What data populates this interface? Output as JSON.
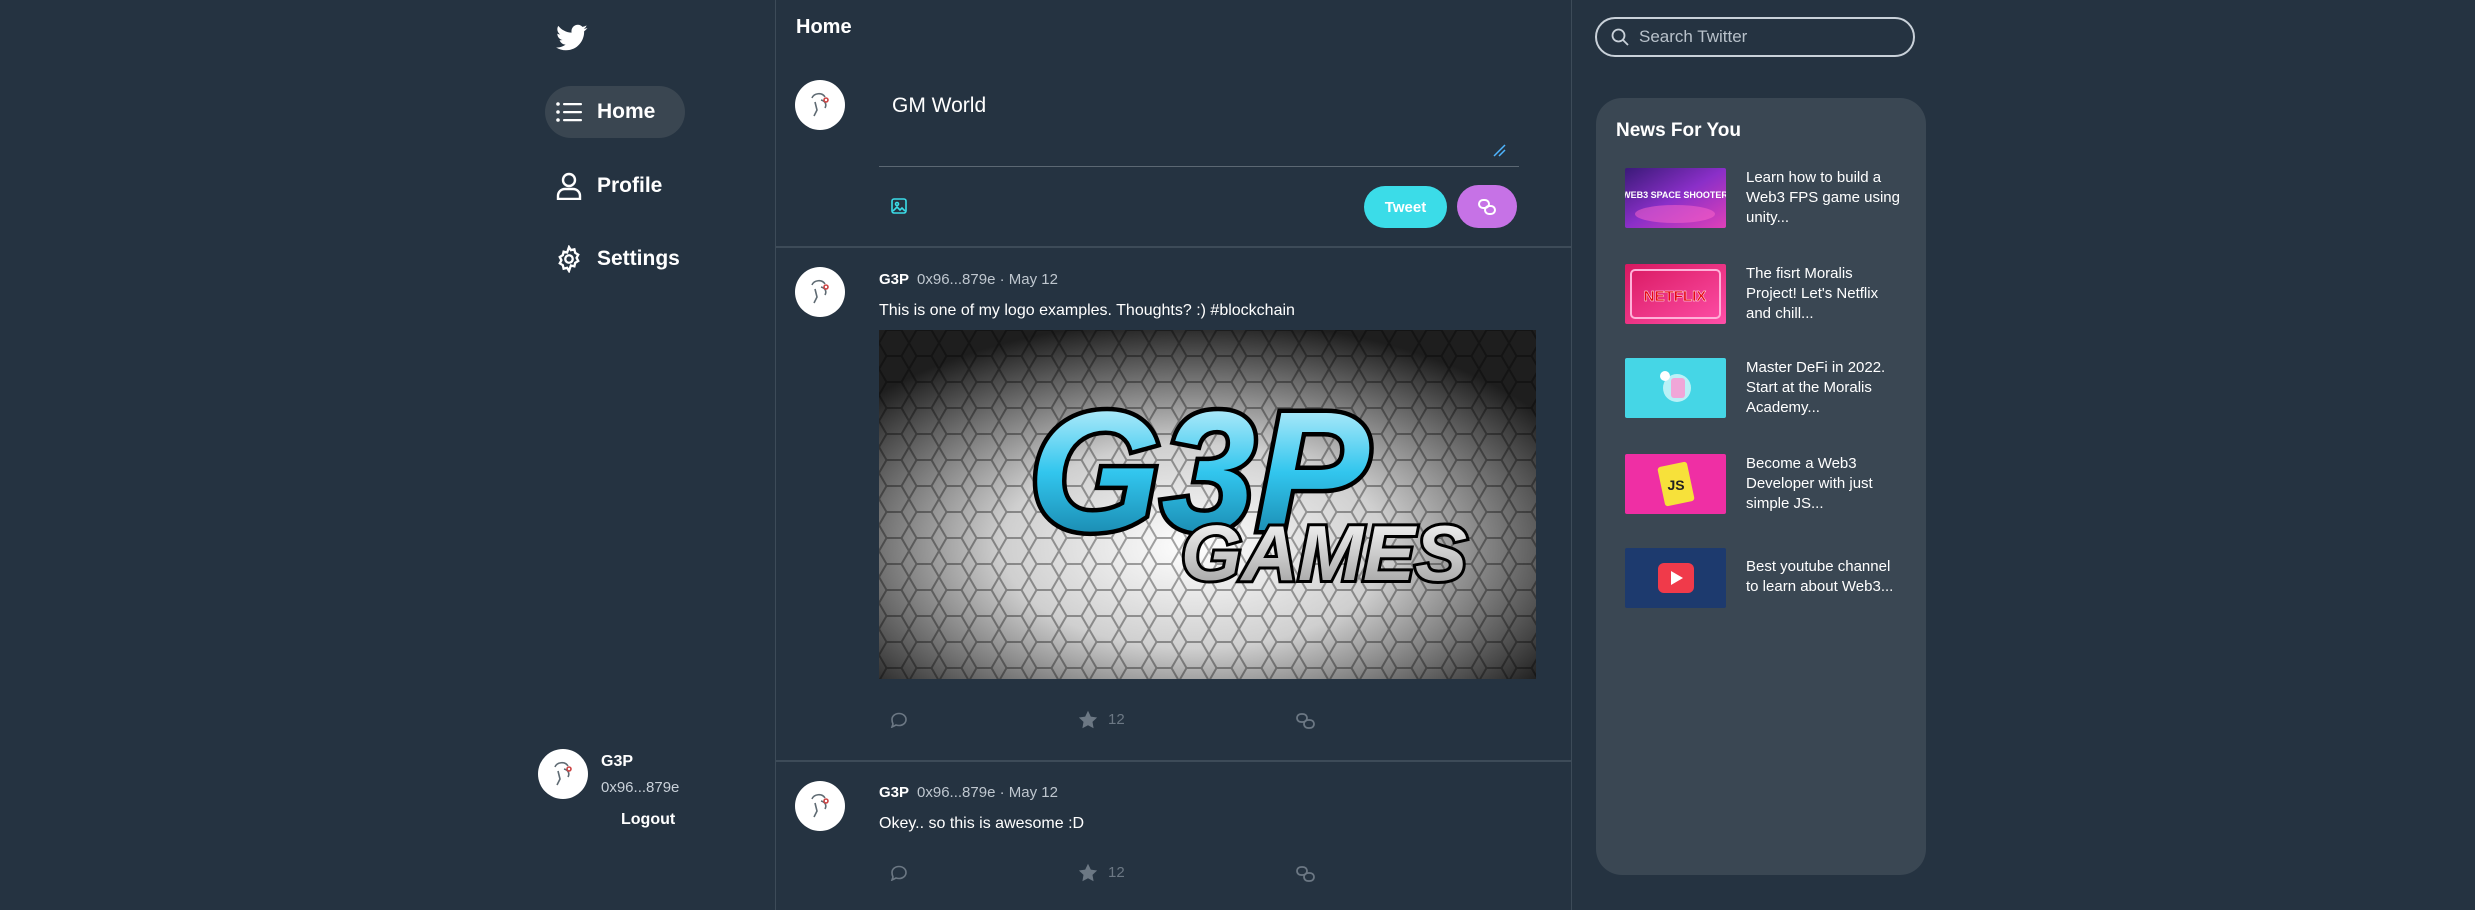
{
  "nav": {
    "home_label": "Home",
    "profile_label": "Profile",
    "settings_label": "Settings"
  },
  "user": {
    "name": "G3P",
    "handle": "0x96...879e",
    "logout_label": "Logout"
  },
  "feed": {
    "title": "Home",
    "compose_text": "GM World",
    "tweet_button": "Tweet"
  },
  "posts": [
    {
      "name": "G3P",
      "meta": "0x96...879e · May 12",
      "text": "This is one of my logo examples. Thoughts? :) #blockchain",
      "likes": "12",
      "image_text_top": "G3P",
      "image_text_bottom": "GAMES"
    },
    {
      "name": "G3P",
      "meta": "0x96...879e · May 12",
      "text": "Okey.. so this is awesome :D",
      "likes": "12"
    }
  ],
  "search": {
    "placeholder": "Search Twitter"
  },
  "news": {
    "title": "News For You",
    "items": [
      {
        "text": "Learn how to build a Web3 FPS game using unity...",
        "thumb_text": "WEB3 SPACE SHOOTER"
      },
      {
        "text": "The fisrt Moralis Project! Let's Netflix and chill...",
        "thumb_text": "NETFLIX"
      },
      {
        "text": "Master DeFi in 2022. Start at the Moralis Academy..."
      },
      {
        "text": "Become a Web3 Developer with just simple JS...",
        "thumb_text": "JS"
      },
      {
        "text": "Best youtube channel to learn about Web3..."
      }
    ]
  },
  "colors": {
    "background": "#253341",
    "panel": "#3a4753",
    "tweet_button": "#3bdce8",
    "nft_button": "#c672e6",
    "action_gray": "#6c7884"
  },
  "icons": [
    "twitter-bird-icon",
    "list-icon",
    "user-icon",
    "gear-icon",
    "image-icon",
    "chain-link-icon",
    "search-icon",
    "comment-icon",
    "star-icon",
    "resize-grip-icon"
  ]
}
